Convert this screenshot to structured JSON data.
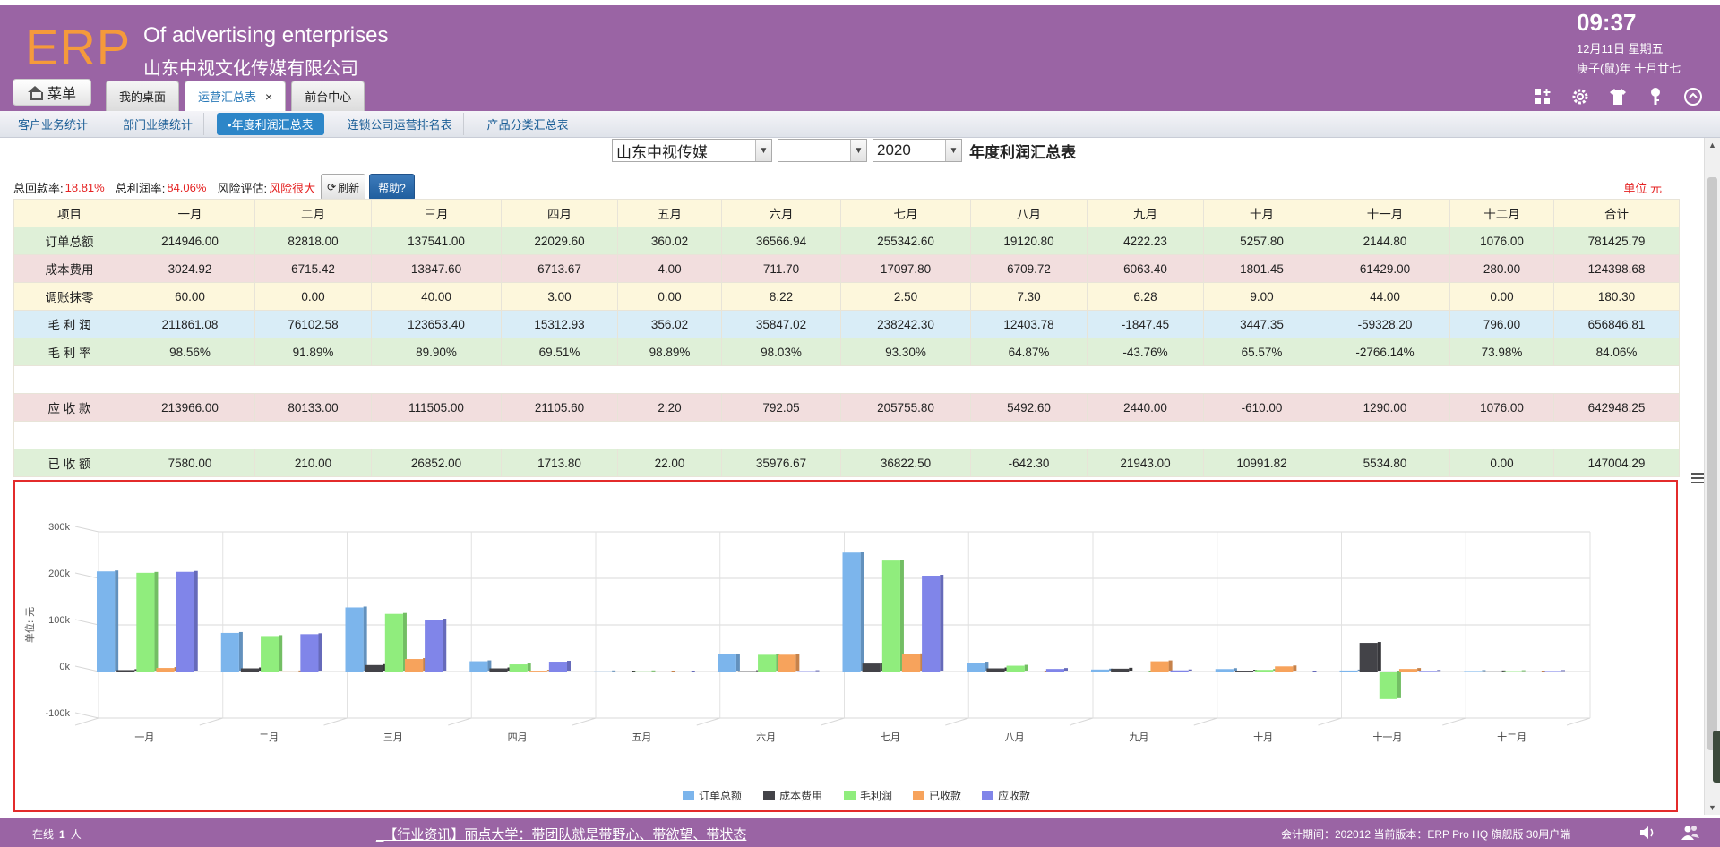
{
  "header": {
    "logo": "ERP",
    "company_en": "Of advertising enterprises",
    "company_cn": "山东中视文化传媒有限公司",
    "time": "09:37",
    "date": "12月11日 星期五",
    "lunar": "庚子(鼠)年 十月廿七",
    "menu_label": "菜单",
    "tabs": [
      {
        "label": "我的桌面"
      },
      {
        "label": "运营汇总表",
        "close": "×"
      },
      {
        "label": "前台中心"
      }
    ],
    "icons": [
      "add-widget-icon",
      "gear-icon",
      "shirt-icon",
      "key-icon",
      "collapse-up-icon"
    ]
  },
  "subtabs": [
    "客户业务统计",
    "部门业绩统计",
    "•年度利润汇总表",
    "连锁公司运营排名表",
    "产品分类汇总表"
  ],
  "filters": {
    "company": "山东中视传媒",
    "second": "",
    "year": "2020",
    "title": "年度利润汇总表"
  },
  "stats": {
    "collect_label": "总回款率:",
    "collect_value": "18.81%",
    "profit_label": "总利润率:",
    "profit_value": "84.06%",
    "risk_label": "风险评估:",
    "risk_value": "风险很大",
    "refresh_label": "刷新",
    "help_label": "帮助?",
    "unit": "单位 元"
  },
  "table": {
    "headers": [
      "项目",
      "一月",
      "二月",
      "三月",
      "四月",
      "五月",
      "六月",
      "七月",
      "八月",
      "九月",
      "十月",
      "十一月",
      "十二月",
      "合计"
    ],
    "rows": [
      {
        "cls": "r-order",
        "cells": [
          "订单总额",
          "214946.00",
          "82818.00",
          "137541.00",
          "22029.60",
          "360.02",
          "36566.94",
          "255342.60",
          "19120.80",
          "4222.23",
          "5257.80",
          "2144.80",
          "1076.00",
          "781425.79"
        ]
      },
      {
        "cls": "r-cost",
        "cells": [
          "成本费用",
          "3024.92",
          "6715.42",
          "13847.60",
          "6713.67",
          "4.00",
          "711.70",
          "17097.80",
          "6709.72",
          "6063.40",
          "1801.45",
          "61429.00",
          "280.00",
          "124398.68"
        ]
      },
      {
        "cls": "r-adjust",
        "cells": [
          "调账抹零",
          "60.00",
          "0.00",
          "40.00",
          "3.00",
          "0.00",
          "8.22",
          "2.50",
          "7.30",
          "6.28",
          "9.00",
          "44.00",
          "0.00",
          "180.30"
        ]
      },
      {
        "cls": "r-profit",
        "cells": [
          "毛 利 润",
          "211861.08",
          "76102.58",
          "123653.40",
          "15312.93",
          "356.02",
          "35847.02",
          "238242.30",
          "12403.78",
          "-1847.45",
          "3447.35",
          "-59328.20",
          "796.00",
          "656846.81"
        ]
      },
      {
        "cls": "r-rate",
        "cells": [
          "毛 利 率",
          "98.56%",
          "91.89%",
          "89.90%",
          "69.51%",
          "98.89%",
          "98.03%",
          "93.30%",
          "64.87%",
          "-43.76%",
          "65.57%",
          "-2766.14%",
          "73.98%",
          "84.06%"
        ]
      },
      {
        "cls": "r-gap",
        "cells": []
      },
      {
        "cls": "r-receivable",
        "cells": [
          "应 收 款",
          "213966.00",
          "80133.00",
          "111505.00",
          "21105.60",
          "2.20",
          "792.05",
          "205755.80",
          "5492.60",
          "2440.00",
          "-610.00",
          "1290.00",
          "1076.00",
          "642948.25"
        ]
      },
      {
        "cls": "r-gap",
        "cells": []
      },
      {
        "cls": "r-received",
        "cells": [
          "已 收 额",
          "7580.00",
          "210.00",
          "26852.00",
          "1713.80",
          "22.00",
          "35976.67",
          "36822.50",
          "-642.30",
          "21943.00",
          "10991.82",
          "5534.80",
          "0.00",
          "147004.29"
        ]
      }
    ]
  },
  "chart_data": {
    "type": "bar",
    "ylabel": "单位: 元",
    "ylim": [
      -100000,
      300000
    ],
    "yticks": [
      "300k",
      "200k",
      "100k",
      "0k",
      "-100k"
    ],
    "categories": [
      "一月",
      "二月",
      "三月",
      "四月",
      "五月",
      "六月",
      "七月",
      "八月",
      "九月",
      "十月",
      "十一月",
      "十二月"
    ],
    "series": [
      {
        "name": "订单总额",
        "color": "#7cb5ec",
        "values": [
          214946,
          82818,
          137541,
          22029.6,
          360.02,
          36566.94,
          255342.6,
          19120.8,
          4222.23,
          5257.8,
          2144.8,
          1076
        ]
      },
      {
        "name": "成本费用",
        "color": "#434348",
        "values": [
          3024.92,
          6715.42,
          13847.6,
          6713.67,
          4,
          711.7,
          17097.8,
          6709.72,
          6063.4,
          1801.45,
          61429,
          280
        ]
      },
      {
        "name": "毛利润",
        "color": "#90ed7d",
        "values": [
          211861.08,
          76102.58,
          123653.4,
          15312.93,
          356.02,
          35847.02,
          238242.3,
          12403.78,
          -1847.45,
          3447.35,
          -59328.2,
          796
        ]
      },
      {
        "name": "已收款",
        "color": "#f7a35c",
        "values": [
          7580,
          210,
          26852,
          1713.8,
          22,
          35976.67,
          36822.5,
          -642.3,
          21943,
          10991.82,
          5534.8,
          0
        ]
      },
      {
        "name": "应收款",
        "color": "#8085e9",
        "values": [
          213966,
          80133,
          111505,
          21105.6,
          2.2,
          792.05,
          205755.8,
          5492.6,
          2440,
          -610,
          1290,
          1076
        ]
      }
    ],
    "legend": "bottom-center",
    "grid": true
  },
  "footer": {
    "online_label": "在线",
    "online_count": "1",
    "online_unit": "人",
    "news": "_【行业资讯】丽点大学：带团队就是带野心、带欲望、带状态",
    "period": "会计期间：202012 当前版本：ERP Pro HQ 旗舰版 30用户端"
  }
}
